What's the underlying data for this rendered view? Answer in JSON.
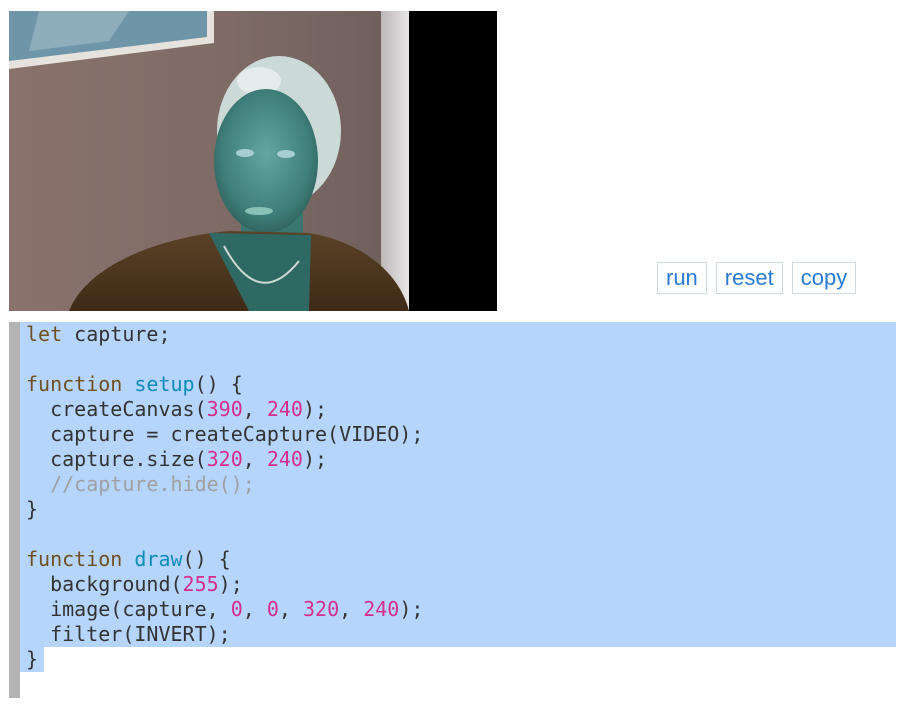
{
  "buttons": {
    "run": "run",
    "reset": "reset",
    "copy": "copy"
  },
  "code_lines": [
    [
      {
        "t": "let",
        "c": "kw"
      },
      {
        "t": " capture;",
        "c": "plain"
      }
    ],
    [],
    [
      {
        "t": "function",
        "c": "kw"
      },
      {
        "t": " ",
        "c": "plain"
      },
      {
        "t": "setup",
        "c": "fn"
      },
      {
        "t": "() {",
        "c": "plain"
      }
    ],
    [
      {
        "t": "  createCanvas(",
        "c": "plain"
      },
      {
        "t": "390",
        "c": "num"
      },
      {
        "t": ", ",
        "c": "plain"
      },
      {
        "t": "240",
        "c": "num"
      },
      {
        "t": ");",
        "c": "plain"
      }
    ],
    [
      {
        "t": "  capture = createCapture(VIDEO);",
        "c": "plain"
      }
    ],
    [
      {
        "t": "  capture.size(",
        "c": "plain"
      },
      {
        "t": "320",
        "c": "num"
      },
      {
        "t": ", ",
        "c": "plain"
      },
      {
        "t": "240",
        "c": "num"
      },
      {
        "t": ");",
        "c": "plain"
      }
    ],
    [
      {
        "t": "  //capture.hide();",
        "c": "cm"
      }
    ],
    [
      {
        "t": "}",
        "c": "plain"
      }
    ],
    [],
    [
      {
        "t": "function",
        "c": "kw"
      },
      {
        "t": " ",
        "c": "plain"
      },
      {
        "t": "draw",
        "c": "fn"
      },
      {
        "t": "() {",
        "c": "plain"
      }
    ],
    [
      {
        "t": "  background(",
        "c": "plain"
      },
      {
        "t": "255",
        "c": "num"
      },
      {
        "t": ");",
        "c": "plain"
      }
    ],
    [
      {
        "t": "  image(capture, ",
        "c": "plain"
      },
      {
        "t": "0",
        "c": "num"
      },
      {
        "t": ", ",
        "c": "plain"
      },
      {
        "t": "0",
        "c": "num"
      },
      {
        "t": ", ",
        "c": "plain"
      },
      {
        "t": "320",
        "c": "num"
      },
      {
        "t": ", ",
        "c": "plain"
      },
      {
        "t": "240",
        "c": "num"
      },
      {
        "t": ");",
        "c": "plain"
      }
    ],
    [
      {
        "t": "  filter(INVERT);",
        "c": "plain"
      }
    ],
    [
      {
        "t": "}",
        "c": "plain"
      }
    ]
  ],
  "colors": {
    "selection": "#b5d5fd",
    "keyword": "#704f21",
    "function_name": "#0b8bb8",
    "number": "#d72e8e",
    "comment": "#a0a0a0",
    "button_text": "#2a7bd4"
  }
}
